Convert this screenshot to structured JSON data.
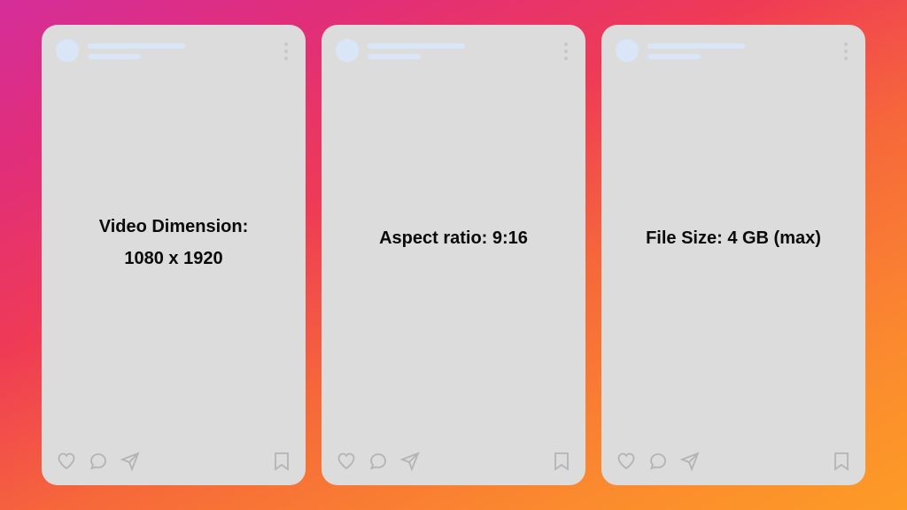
{
  "cards": [
    {
      "line1": "Video Dimension:",
      "line2": "1080 x 1920"
    },
    {
      "line1": "Aspect ratio: 9:16",
      "line2": ""
    },
    {
      "line1": "File Size: 4 GB (max)",
      "line2": ""
    }
  ]
}
